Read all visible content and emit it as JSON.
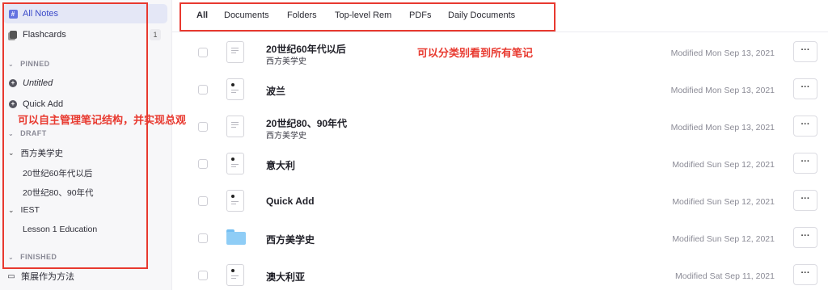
{
  "sidebar": {
    "all_notes": "All Notes",
    "flashcards": "Flashcards",
    "flashcards_count": "1",
    "pinned_header": "PINNED",
    "untitled": "Untitled",
    "quick_add": "Quick Add",
    "draft_header": "DRAFT",
    "tree_1": "西方美学史",
    "tree_1_child_1": "20世纪60年代以后",
    "tree_1_child_2": "20世纪80、90年代",
    "tree_2": "IEST",
    "tree_2_child_1": "Lesson 1 Education",
    "finished_header": "FINISHED",
    "bottom_item": "策展作为方法"
  },
  "tabs": [
    "All",
    "Documents",
    "Folders",
    "Top-level Rem",
    "PDFs",
    "Daily Documents"
  ],
  "rows": [
    {
      "title": "20世纪60年代以后",
      "subtitle": "西方美学史",
      "modified": "Modified Mon Sep 13, 2021",
      "icon": "document-lines-icon"
    },
    {
      "title": "波兰",
      "subtitle": "",
      "modified": "Modified Mon Sep 13, 2021",
      "icon": "document-dot-icon"
    },
    {
      "title": "20世纪80、90年代",
      "subtitle": "西方美学史",
      "modified": "Modified Mon Sep 13, 2021",
      "icon": "document-lines-icon"
    },
    {
      "title": "意大利",
      "subtitle": "",
      "modified": "Modified Sun Sep 12, 2021",
      "icon": "document-dot-icon"
    },
    {
      "title": "Quick Add",
      "subtitle": "",
      "modified": "Modified Sun Sep 12, 2021",
      "icon": "document-dot-icon"
    },
    {
      "title": "西方美学史",
      "subtitle": "",
      "modified": "Modified Sun Sep 12, 2021",
      "icon": "folder-icon"
    },
    {
      "title": "澳大利亚",
      "subtitle": "",
      "modified": "Modified Sat Sep 11, 2021",
      "icon": "document-dot-icon"
    }
  ],
  "more_label": "···",
  "annotations": {
    "sidebar_note": "可以自主管理笔记结构，并实现总观",
    "tabs_note": "可以分类别看到所有笔记"
  },
  "colors": {
    "accent": "#3f4fd1",
    "annotation": "#e8392f",
    "folder": "#8fcdf6"
  }
}
